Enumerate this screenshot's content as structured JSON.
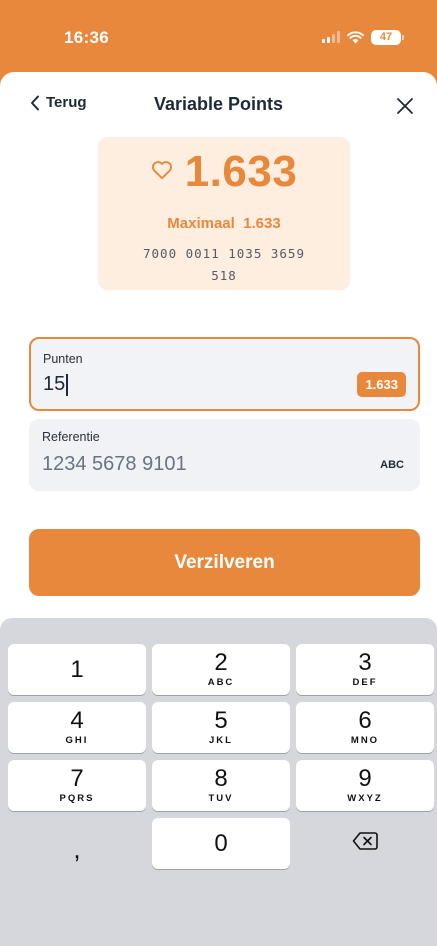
{
  "status_bar": {
    "time": "16:36",
    "battery_level": "47"
  },
  "header": {
    "back_label": "Terug",
    "title": "Variable Points"
  },
  "card": {
    "balance": "1.633",
    "max_text": "Maximaal  1.633",
    "card_number_line1": "7000 0011 1035 3659",
    "card_number_line2": "518"
  },
  "points_field": {
    "label": "Punten",
    "value": "15",
    "max_badge": "1.633"
  },
  "reference_field": {
    "label": "Referentie",
    "placeholder": "1234 5678 9101",
    "keyboard_hint": "ABC"
  },
  "redeem_button": {
    "label": "Verzilveren"
  },
  "keyboard": {
    "keys": [
      {
        "digit": "1",
        "letters": ""
      },
      {
        "digit": "2",
        "letters": "ABC"
      },
      {
        "digit": "3",
        "letters": "DEF"
      },
      {
        "digit": "4",
        "letters": "GHI"
      },
      {
        "digit": "5",
        "letters": "JKL"
      },
      {
        "digit": "6",
        "letters": "MNO"
      },
      {
        "digit": "7",
        "letters": "PQRS"
      },
      {
        "digit": "8",
        "letters": "TUV"
      },
      {
        "digit": "9",
        "letters": "WXYZ"
      },
      {
        "digit": ",",
        "letters": ""
      },
      {
        "digit": "0",
        "letters": ""
      }
    ]
  },
  "colors": {
    "accent": "#e8883c",
    "card_background": "#fdeedf",
    "field_background": "#f0f2f6",
    "keyboard_background": "#d5d7dd"
  }
}
